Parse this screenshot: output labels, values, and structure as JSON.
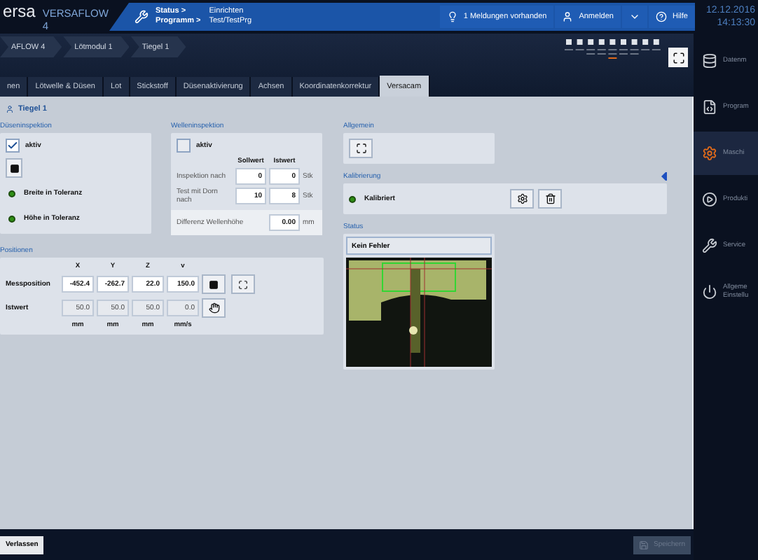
{
  "header": {
    "logo": "ersa",
    "product": "VERSAFLOW 4",
    "status_label": "Status >",
    "status_value": "Einrichten",
    "program_label": "Programm >",
    "program_value": "Test/TestPrg",
    "messages": "1 Meldungen vorhanden",
    "login": "Anmelden",
    "help": "Hilfe"
  },
  "datetime": {
    "date": "12.12.2016",
    "time": "14:13:30"
  },
  "breadcrumbs": [
    "AFLOW 4",
    "Lötmodul 1",
    "Tiegel 1"
  ],
  "tabs": [
    {
      "label": "nen",
      "selected": false
    },
    {
      "label": "Lötwelle & Düsen",
      "selected": false
    },
    {
      "label": "Lot",
      "selected": false
    },
    {
      "label": "Stickstoff",
      "selected": false
    },
    {
      "label": "Düsenaktivierung",
      "selected": false
    },
    {
      "label": "Achsen",
      "selected": false
    },
    {
      "label": "Koordinatenkorrektur",
      "selected": false
    },
    {
      "label": "Versacam",
      "selected": true
    }
  ],
  "page_title": "Tiegel 1",
  "nozzle_inspection": {
    "title": "Düseninspektion",
    "active": {
      "label": "aktiv",
      "checked": true
    },
    "indicators": [
      {
        "label": "Breite in Toleranz",
        "ok": true
      },
      {
        "label": "Höhe in Toleranz",
        "ok": true
      }
    ]
  },
  "wave_inspection": {
    "title": "Welleninspektion",
    "active": {
      "label": "aktiv",
      "checked": false
    },
    "columns": [
      "Sollwert",
      "Istwert"
    ],
    "rows": [
      {
        "label": "Inspektion nach",
        "setpoint": "0",
        "actual": "0",
        "unit": "Stk"
      },
      {
        "label": "Test mit Dorn nach",
        "setpoint": "10",
        "actual": "8",
        "unit": "Stk"
      }
    ],
    "difference": {
      "label": "Differenz Wellenhöhe",
      "value": "0.00",
      "unit": "mm"
    }
  },
  "positions": {
    "title": "Positionen",
    "axes": [
      "X",
      "Y",
      "Z",
      "v"
    ],
    "rows": [
      {
        "label": "Messposition",
        "values": [
          "-452.4",
          "-262.7",
          "22.0",
          "150.0"
        ],
        "editable": true
      },
      {
        "label": "Istwert",
        "values": [
          "50.0",
          "50.0",
          "50.0",
          "0.0"
        ],
        "editable": false
      }
    ],
    "units": [
      "mm",
      "mm",
      "mm",
      "mm/s"
    ]
  },
  "general": {
    "title": "Allgemein"
  },
  "calibration": {
    "title": "Kalibrierung",
    "status": {
      "label": "Kalibriert",
      "ok": true
    }
  },
  "status": {
    "title": "Status",
    "message": "Kein Fehler"
  },
  "sidebar": [
    {
      "lines": [
        "Datenm"
      ],
      "selected": false
    },
    {
      "lines": [
        "Program"
      ],
      "selected": false
    },
    {
      "lines": [
        "Maschi"
      ],
      "selected": true
    },
    {
      "lines": [
        "Produkti"
      ],
      "selected": false
    },
    {
      "lines": [
        "Service"
      ],
      "selected": false
    },
    {
      "lines": [
        "Allgeme",
        "Einstellu"
      ],
      "selected": false
    }
  ],
  "footer": {
    "exit": "Verlassen",
    "save": {
      "label": "Speichern",
      "disabled": true
    }
  }
}
